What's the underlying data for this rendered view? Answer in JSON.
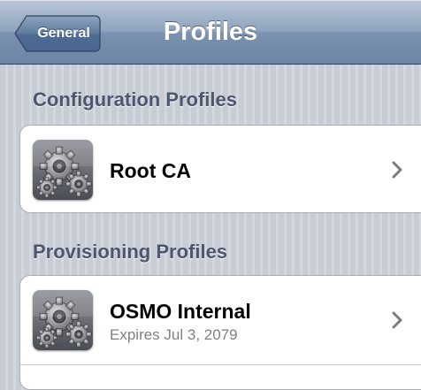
{
  "navbar": {
    "back_label": "General",
    "title": "Profiles"
  },
  "sections": {
    "configuration": {
      "header": "Configuration Profiles",
      "items": [
        {
          "title": "Root CA",
          "icon": "settings-gear-icon"
        }
      ]
    },
    "provisioning": {
      "header": "Provisioning Profiles",
      "items": [
        {
          "title": "OSMO Internal",
          "subtitle": "Expires Jul 3, 2079",
          "icon": "settings-gear-icon"
        }
      ]
    }
  },
  "colors": {
    "navbar": "#6d86a6",
    "background": "#c7ccd5",
    "section_header": "#4c566c"
  }
}
